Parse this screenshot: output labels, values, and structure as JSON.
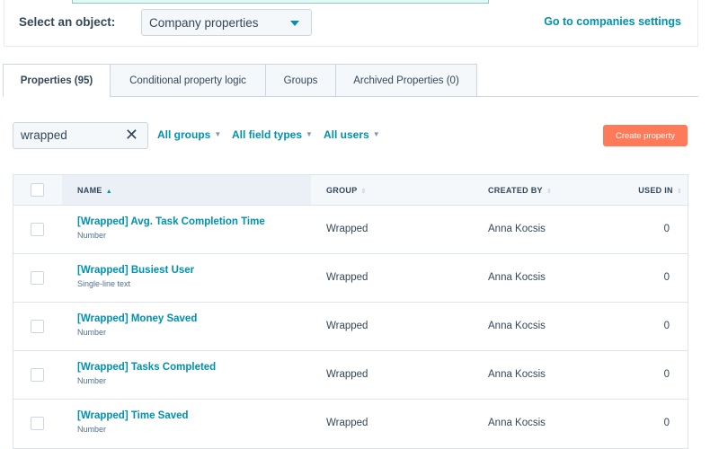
{
  "header": {
    "select_label": "Select an object:",
    "object_value": "Company properties",
    "settings_link": "Go to companies settings"
  },
  "tabs": [
    {
      "label": "Properties (95)",
      "active": true
    },
    {
      "label": "Conditional property logic"
    },
    {
      "label": "Groups"
    },
    {
      "label": "Archived Properties (0)"
    }
  ],
  "filters": {
    "search_value": "wrapped",
    "clear_icon": "✕",
    "groups": "All groups",
    "field_types": "All field types",
    "users": "All users",
    "create_label": "Create property"
  },
  "colors": {
    "accent": "#0091ae",
    "create_button": "#ff7a59"
  },
  "table": {
    "columns": {
      "name": "NAME",
      "group": "GROUP",
      "created_by": "CREATED BY",
      "used_in": "USED IN"
    },
    "sorted_by": "NAME ascending",
    "rows": [
      {
        "name": "[Wrapped] Avg. Task Completion Time",
        "type": "Number",
        "group": "Wrapped",
        "created_by": "Anna Kocsis",
        "used_in": "0"
      },
      {
        "name": "[Wrapped] Busiest User",
        "type": "Single-line text",
        "group": "Wrapped",
        "created_by": "Anna Kocsis",
        "used_in": "0"
      },
      {
        "name": "[Wrapped] Money Saved",
        "type": "Number",
        "group": "Wrapped",
        "created_by": "Anna Kocsis",
        "used_in": "0"
      },
      {
        "name": "[Wrapped] Tasks Completed",
        "type": "Number",
        "group": "Wrapped",
        "created_by": "Anna Kocsis",
        "used_in": "0"
      },
      {
        "name": "[Wrapped] Time Saved",
        "type": "Number",
        "group": "Wrapped",
        "created_by": "Anna Kocsis",
        "used_in": "0"
      }
    ]
  }
}
